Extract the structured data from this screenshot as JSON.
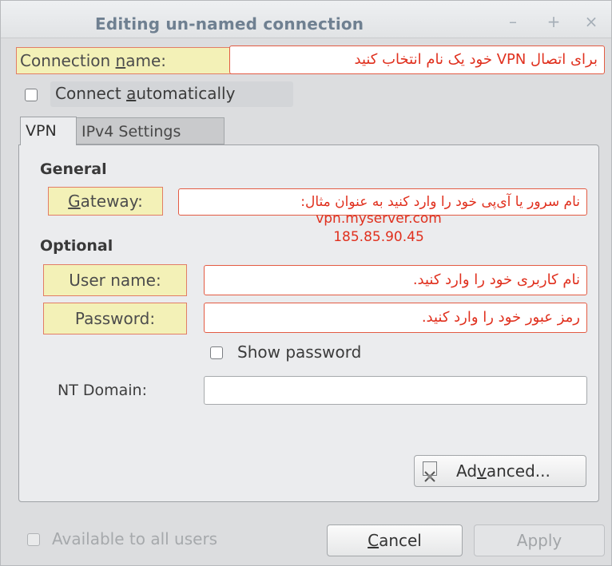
{
  "window": {
    "title": "Editing un-named connection",
    "controls": {
      "minimize": "–",
      "maximize": "+",
      "close": "×"
    }
  },
  "connection_name": {
    "label_prefix": "Connection ",
    "label_mnemonic": "n",
    "label_suffix": "ame:",
    "value": "برای اتصال VPN خود یک نام انتخاب کنید"
  },
  "connect_automatically": {
    "label_prefix": "Connect ",
    "label_mnemonic": "a",
    "label_suffix": "utomatically",
    "checked": false
  },
  "tabs": [
    {
      "label": "VPN",
      "active": true
    },
    {
      "label": "IPv4 Settings",
      "active": false
    }
  ],
  "vpn": {
    "general_heading": "General",
    "gateway": {
      "label_mnemonic": "G",
      "label_suffix": "ateway:",
      "value": "نام سرور یا آی‌پی خود را وارد کنید به عنوان مثال:",
      "example_1": "vpn.myserver.com",
      "example_2": "185.85.90.45"
    },
    "optional_heading": "Optional",
    "user_name": {
      "label": "User name:",
      "value": "نام کاربری خود را وارد کنید."
    },
    "password": {
      "label": "Password:",
      "value": "رمز عبور خود را وارد کنید."
    },
    "show_password": {
      "label": "Show password",
      "checked": false
    },
    "nt_domain": {
      "label": "NT Domain:",
      "value": ""
    },
    "advanced_button": {
      "prefix": "Ad",
      "mnemonic": "v",
      "suffix": "anced...",
      "icon": "tools-icon"
    }
  },
  "footer": {
    "available_to_all_users": {
      "label": "Available to all users",
      "checked": false,
      "enabled": false
    },
    "cancel": {
      "mnemonic": "C",
      "suffix": "ancel"
    },
    "apply": {
      "label": "Apply",
      "enabled": false
    }
  },
  "colors": {
    "annotation_red": "#e0301e",
    "highlight_yellow": "#f3f1b7",
    "title_color": "#6f8091"
  }
}
